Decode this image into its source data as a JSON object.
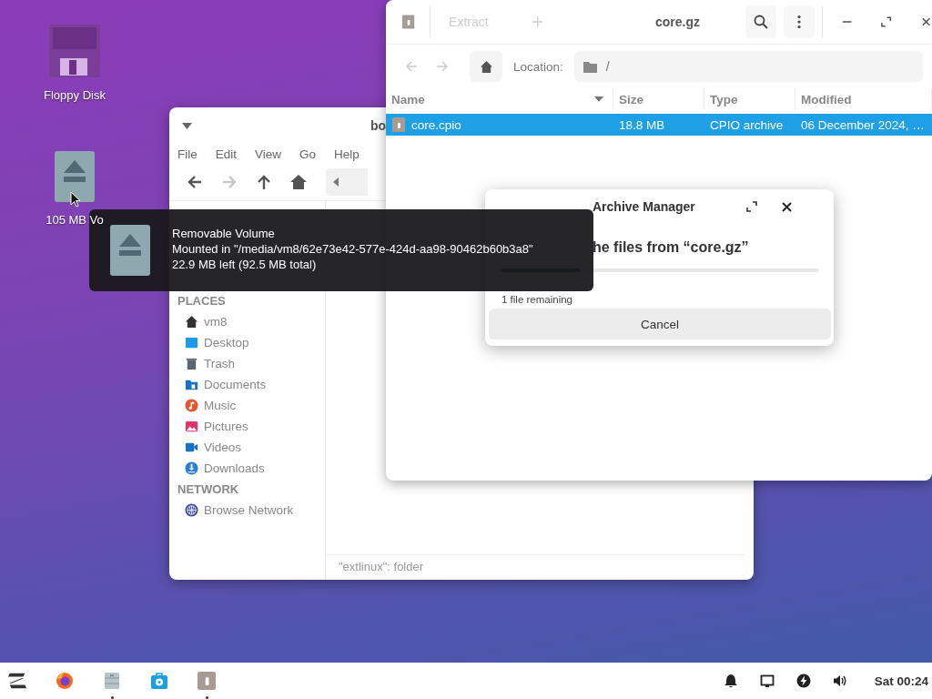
{
  "desktop_icons": [
    {
      "label": "Floppy Disk",
      "kind": "floppy"
    },
    {
      "label": "105 MB Vo",
      "kind": "drive"
    }
  ],
  "file_manager": {
    "title": "bo",
    "menu": [
      "File",
      "Edit",
      "View",
      "Go",
      "Help"
    ],
    "toolbar": [
      {
        "kind": "back",
        "disabled": false
      },
      {
        "kind": "forward",
        "disabled": true
      },
      {
        "kind": "up",
        "disabled": false
      },
      {
        "kind": "home",
        "disabled": false
      }
    ],
    "sidebar": [
      {
        "heading": "PLACES",
        "items": [
          {
            "label": "vm8",
            "kind": "home"
          },
          {
            "label": "Desktop",
            "kind": "desktop"
          },
          {
            "label": "Trash",
            "kind": "trash"
          },
          {
            "label": "Documents",
            "kind": "documents"
          },
          {
            "label": "Music",
            "kind": "music"
          },
          {
            "label": "Pictures",
            "kind": "pictures"
          },
          {
            "label": "Videos",
            "kind": "videos"
          },
          {
            "label": "Downloads",
            "kind": "downloads"
          }
        ]
      },
      {
        "heading": "NETWORK",
        "items": [
          {
            "label": "Browse Network",
            "kind": "network"
          }
        ]
      }
    ],
    "status": "\"extlinux\": folder"
  },
  "archive_manager": {
    "title": "core.gz",
    "extract": {
      "label": "Extract",
      "disabled": true
    },
    "back_disabled": true,
    "forward_disabled": true,
    "location_label": "Location:",
    "location": "/",
    "columns": [
      {
        "label": "Name",
        "sorted": true
      },
      {
        "label": "Size",
        "sorted": false
      },
      {
        "label": "Type",
        "sorted": false
      },
      {
        "label": "Modified",
        "sorted": false
      }
    ],
    "rows": [
      {
        "cells": [
          "core.cpio",
          "18.8 MB",
          "CPIO archive",
          "06 December 2024, …"
        ],
        "selected": true
      }
    ]
  },
  "dialog": {
    "title": "Archive Manager",
    "heading": "he files from “core.gz”",
    "level": 0.25,
    "remaining": "1 file remaining",
    "button": "Cancel"
  },
  "tooltip": {
    "title": "Removable Volume",
    "lines": [
      "Mounted in \"/media/vm8/62e73e42-577e-424d-aa98-90462b60b3a8\"",
      "22.9 MB left (92.5 MB total)"
    ]
  },
  "taskbar": {
    "apps": [
      {
        "kind": "zorin",
        "running": false
      },
      {
        "kind": "firefox",
        "running": false
      },
      {
        "kind": "files",
        "running": true
      },
      {
        "kind": "store",
        "running": false
      },
      {
        "kind": "archive",
        "running": true
      }
    ],
    "tray": [
      {
        "kind": "bell"
      },
      {
        "kind": "screen"
      },
      {
        "kind": "power"
      },
      {
        "kind": "volume"
      }
    ],
    "clock": "Sat 00:24"
  }
}
